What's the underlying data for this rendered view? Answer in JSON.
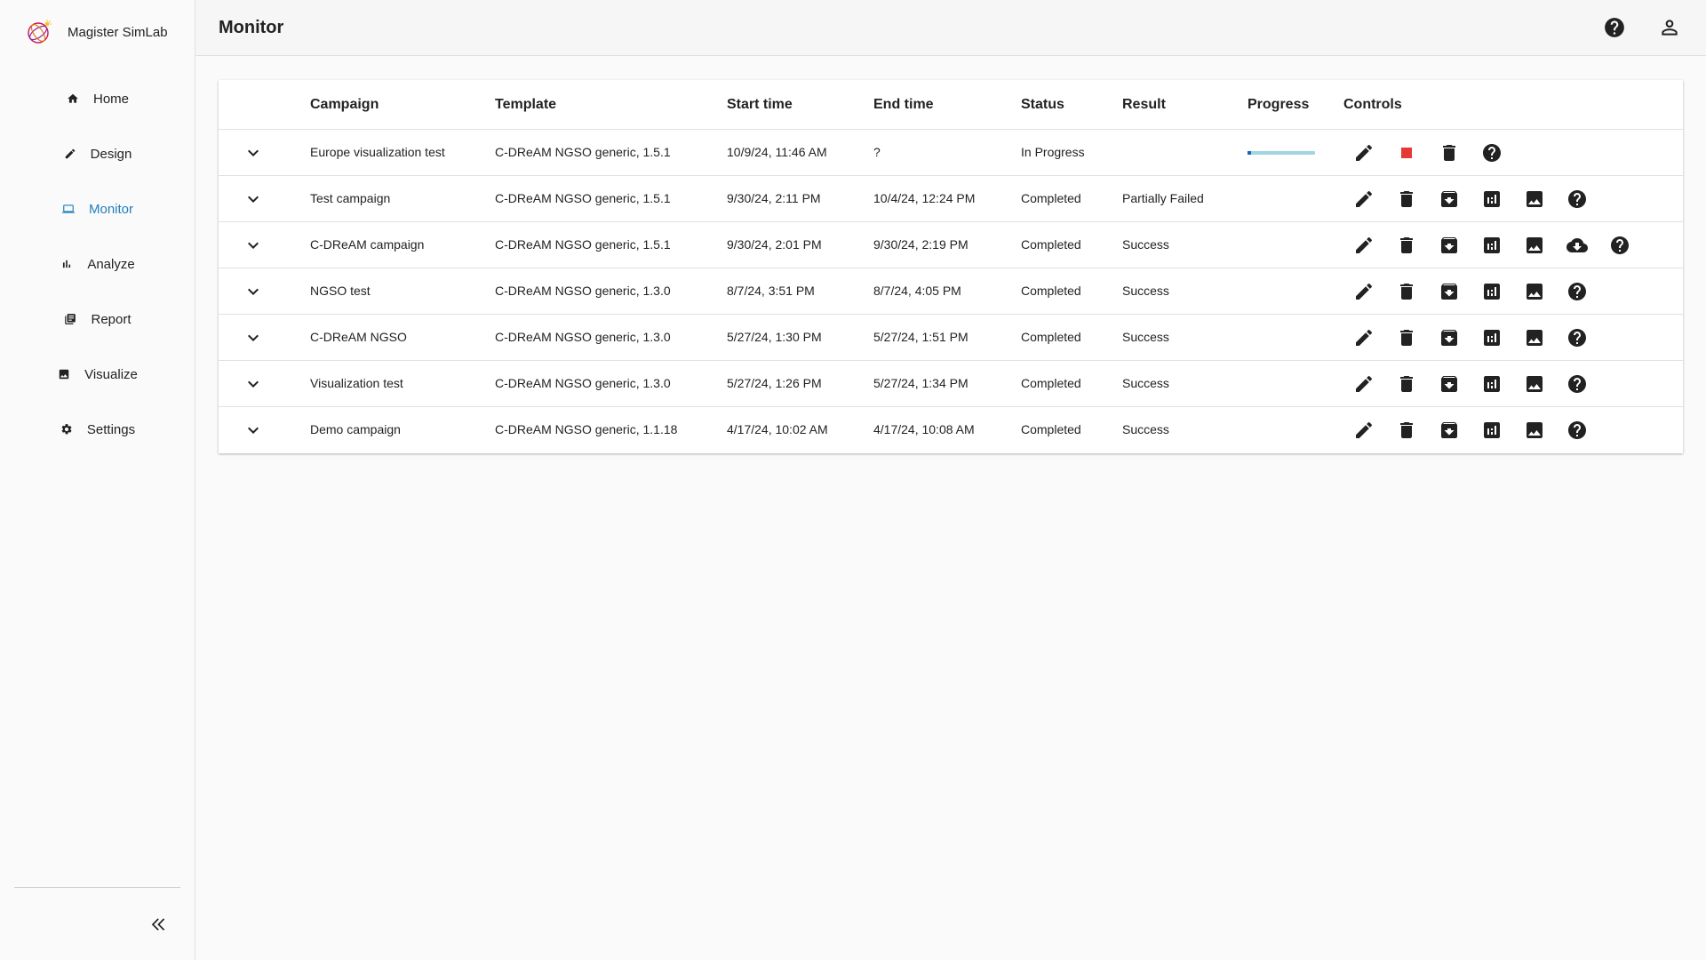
{
  "app": {
    "name": "Magister SimLab"
  },
  "sidebar": {
    "items": [
      {
        "label": "Home",
        "icon": "home-icon",
        "active": false
      },
      {
        "label": "Design",
        "icon": "pencil-icon",
        "active": false
      },
      {
        "label": "Monitor",
        "icon": "monitor-icon",
        "active": true
      },
      {
        "label": "Analyze",
        "icon": "bar-chart-icon",
        "active": false
      },
      {
        "label": "Report",
        "icon": "report-icon",
        "active": false
      },
      {
        "label": "Visualize",
        "icon": "image-icon",
        "active": false
      },
      {
        "label": "Settings",
        "icon": "gear-icon",
        "active": false
      }
    ],
    "collapse_icon": "double-chevron-left-icon"
  },
  "header": {
    "title": "Monitor",
    "icons": [
      "help-icon",
      "account-icon"
    ]
  },
  "table": {
    "columns": [
      "Campaign",
      "Template",
      "Start time",
      "End time",
      "Status",
      "Result",
      "Progress",
      "Controls"
    ],
    "rows": [
      {
        "campaign": "Europe visualization test",
        "template": "C-DReAM NGSO generic, 1.5.1",
        "start": "10/9/24, 11:46 AM",
        "end": "?",
        "status": "In Progress",
        "result": "",
        "progress": 0.05,
        "controls": [
          "edit",
          "stop",
          "delete",
          "help"
        ]
      },
      {
        "campaign": "Test campaign",
        "template": "C-DReAM NGSO generic, 1.5.1",
        "start": "9/30/24, 2:11 PM",
        "end": "10/4/24, 12:24 PM",
        "status": "Completed",
        "result": "Partially Failed",
        "progress": null,
        "controls": [
          "edit",
          "delete",
          "archive",
          "analyze",
          "visualize",
          "help"
        ]
      },
      {
        "campaign": "C-DReAM campaign",
        "template": "C-DReAM NGSO generic, 1.5.1",
        "start": "9/30/24, 2:01 PM",
        "end": "9/30/24, 2:19 PM",
        "status": "Completed",
        "result": "Success",
        "progress": null,
        "controls": [
          "edit",
          "delete",
          "archive",
          "analyze",
          "visualize",
          "download",
          "help"
        ]
      },
      {
        "campaign": "NGSO test",
        "template": "C-DReAM NGSO generic, 1.3.0",
        "start": "8/7/24, 3:51 PM",
        "end": "8/7/24, 4:05 PM",
        "status": "Completed",
        "result": "Success",
        "progress": null,
        "controls": [
          "edit",
          "delete",
          "archive",
          "analyze",
          "visualize",
          "help"
        ]
      },
      {
        "campaign": "C-DReAM NGSO",
        "template": "C-DReAM NGSO generic, 1.3.0",
        "start": "5/27/24, 1:30 PM",
        "end": "5/27/24, 1:51 PM",
        "status": "Completed",
        "result": "Success",
        "progress": null,
        "controls": [
          "edit",
          "delete",
          "archive",
          "analyze",
          "visualize",
          "help"
        ]
      },
      {
        "campaign": "Visualization test",
        "template": "C-DReAM NGSO generic, 1.3.0",
        "start": "5/27/24, 1:26 PM",
        "end": "5/27/24, 1:34 PM",
        "status": "Completed",
        "result": "Success",
        "progress": null,
        "controls": [
          "edit",
          "delete",
          "archive",
          "analyze",
          "visualize",
          "help"
        ]
      },
      {
        "campaign": "Demo campaign",
        "template": "C-DReAM NGSO generic, 1.1.18",
        "start": "4/17/24, 10:02 AM",
        "end": "4/17/24, 10:08 AM",
        "status": "Completed",
        "result": "Success",
        "progress": null,
        "controls": [
          "edit",
          "delete",
          "archive",
          "analyze",
          "visualize",
          "help"
        ]
      }
    ]
  },
  "colors": {
    "accent": "#1f7fbf",
    "stop": "#e53935",
    "progress_track": "#9fd6df",
    "progress_fill": "#1565c0"
  }
}
